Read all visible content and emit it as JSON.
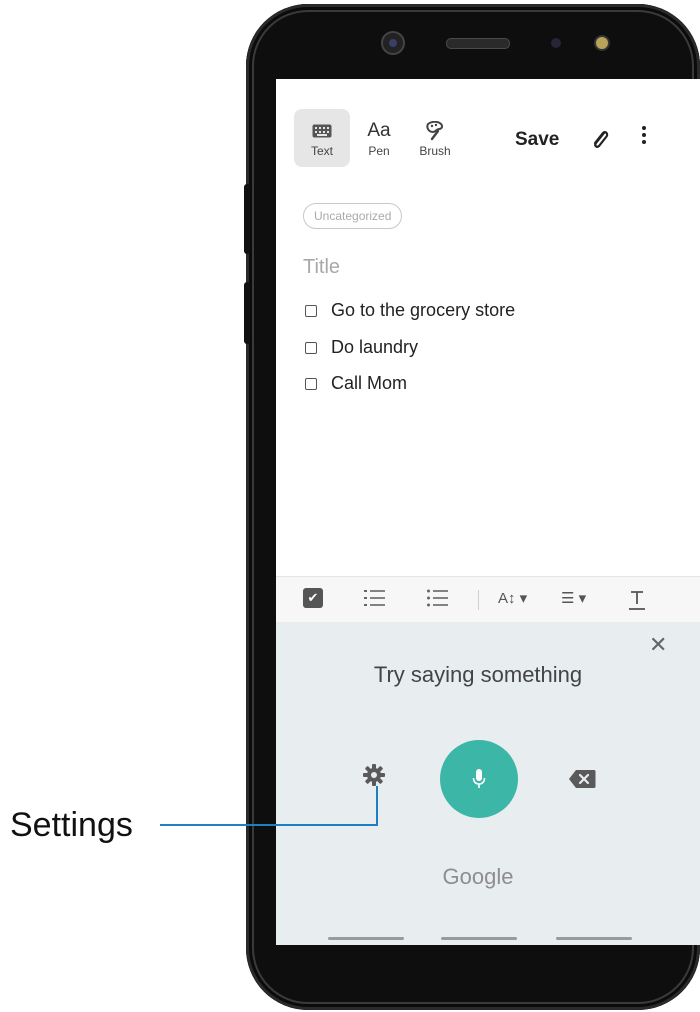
{
  "toolbar": {
    "tools": [
      {
        "label": "Text",
        "icon": "keyboard-icon",
        "active": true
      },
      {
        "label": "Pen",
        "icon": "pen-icon",
        "active": false
      },
      {
        "label": "Brush",
        "icon": "brush-icon",
        "active": false
      }
    ],
    "save_label": "Save",
    "attach_icon": "paperclip-icon",
    "more_icon": "more-vert-icon"
  },
  "note": {
    "category": "Uncategorized",
    "title_placeholder": "Title",
    "checklist": [
      {
        "text": "Go to the grocery store",
        "checked": false
      },
      {
        "text": "Do laundry",
        "checked": false
      },
      {
        "text": "Call Mom",
        "checked": false
      }
    ]
  },
  "format_bar": {
    "icons": [
      "checkbox-icon",
      "numbered-list-icon",
      "bullet-list-icon",
      "text-size-icon",
      "align-icon",
      "text-style-icon"
    ]
  },
  "voice_input": {
    "prompt": "Try saying something",
    "brand": "Google",
    "close_icon": "close-icon",
    "settings_icon": "settings-icon",
    "mic_icon": "mic-icon",
    "backspace_icon": "backspace-icon",
    "mic_color": "#3bb6a7"
  },
  "callout": {
    "label": "Settings",
    "line_color": "#1f7fc1"
  }
}
